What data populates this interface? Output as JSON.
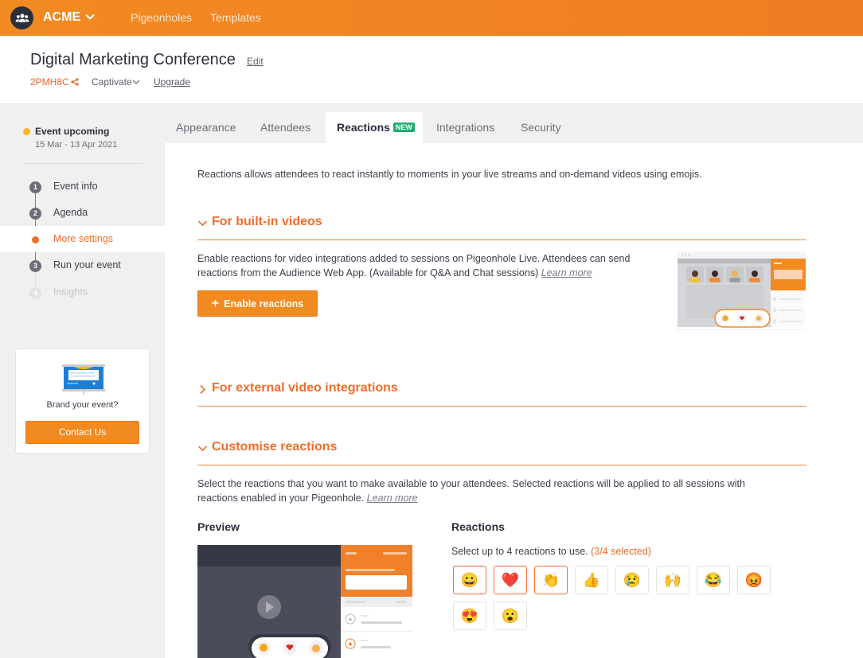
{
  "topbar": {
    "org_name": "ACME",
    "nav": [
      "Pigeonholes",
      "Templates"
    ],
    "brand_color": "#f28a22"
  },
  "header": {
    "title": "Digital Marketing Conference",
    "edit_label": "Edit",
    "code": "2PMH8C",
    "plan": "Captivate",
    "upgrade_label": "Upgrade"
  },
  "sidebar": {
    "status": "Event upcoming",
    "dates": "15 Mar - 13 Apr 2021",
    "steps": [
      {
        "num": "1",
        "label": "Event info"
      },
      {
        "num": "2",
        "label": "Agenda"
      },
      {
        "num": "",
        "label": "More settings",
        "active": true
      },
      {
        "num": "3",
        "label": "Run your event"
      },
      {
        "num": "4",
        "label": "Insights",
        "disabled": true
      }
    ],
    "brand_card": {
      "text": "Brand your event?",
      "button": "Contact Us"
    }
  },
  "tabs": [
    {
      "label": "Appearance"
    },
    {
      "label": "Attendees"
    },
    {
      "label": "Reactions",
      "badge": "NEW",
      "active": true
    },
    {
      "label": "Integrations"
    },
    {
      "label": "Security"
    }
  ],
  "main": {
    "intro": "Reactions allows attendees to react instantly to moments in your live streams and on-demand videos using emojis.",
    "builtin": {
      "title": "For built-in videos",
      "text": "Enable reactions for video integrations added to sessions on Pigeonhole Live. Attendees can send reactions from the Audience Web App. (Available for Q&A and Chat sessions)",
      "learn_more": "Learn more",
      "button": "Enable reactions"
    },
    "external": {
      "title": "For external video integrations"
    },
    "customise": {
      "title": "Customise reactions",
      "text": "Select the reactions that you want to make available to your attendees. Selected reactions will be applied to all sessions with reactions enabled in your Pigeonhole.",
      "learn_more": "Learn more",
      "preview_label": "Preview",
      "reactions_label": "Reactions",
      "hint": "Select up to 4 reactions to use.",
      "count": "(3/4 selected)",
      "emojis": [
        {
          "name": "grinning",
          "char": "😀",
          "selected": true
        },
        {
          "name": "heart",
          "char": "❤️",
          "selected": true
        },
        {
          "name": "clap",
          "char": "👏",
          "selected": true
        },
        {
          "name": "thumbs-up",
          "char": "👍",
          "selected": false
        },
        {
          "name": "sad",
          "char": "😢",
          "selected": false
        },
        {
          "name": "raised-hands",
          "char": "🙌",
          "selected": false
        },
        {
          "name": "laughing",
          "char": "😂",
          "selected": false
        },
        {
          "name": "angry",
          "char": "😡",
          "selected": false
        },
        {
          "name": "heart-eyes",
          "char": "😍",
          "selected": false
        },
        {
          "name": "surprised",
          "char": "😮",
          "selected": false
        }
      ]
    }
  }
}
